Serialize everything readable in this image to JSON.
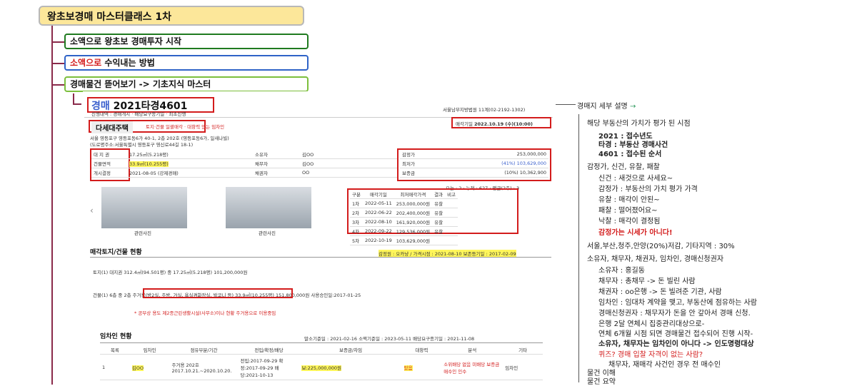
{
  "title": "왕초보경매 마스터클래스 1차",
  "nodes": [
    {
      "text": "소액으로 왕초보 경매투자 시작"
    },
    {
      "text_red": "소액으로",
      "text": " 수익내는 방법"
    },
    {
      "text": "경매물건 뜯어보기 -> 기초지식 마스터"
    }
  ],
  "shot": {
    "case_prefix": "경매",
    "case_no": "2021타경4601",
    "progress": "진행내역 : 경매개시 · 배당요구종기일 · 최초진행",
    "court": "서울남부지방법원 11계(02-2192-1302)",
    "type_badge": "다세대주택",
    "type_note": "토지·건물 일괄매각 · 대항력 있는 임차인",
    "sale_date_label": "매각기일",
    "sale_date": "2022.10.19 (수)(10:00)",
    "address": "서울 영등포구 영등포동6가 40-1, 2층 202호 (영등포동6가, 일새나빌)",
    "address2": "(도로명주소:서울특별시 영등포구 영신로44길 18-1)",
    "info_rows": [
      {
        "k": "대 지 권",
        "v": "17.25㎡(5.218평)",
        "k2": "소유자",
        "v2": "김OO"
      },
      {
        "k": "건물면적",
        "v": "33.9㎡(10.255평)",
        "k2": "채무자",
        "v2": "김OO"
      },
      {
        "k": "개시결정",
        "v": "2021-08-05 (강제경매)",
        "k2": "채권자",
        "v2": "OO"
      }
    ],
    "price_rows": [
      {
        "k": "감정가",
        "v": "253,000,000"
      },
      {
        "k": "최저가",
        "v": "(41%) 103,629,000"
      },
      {
        "k": "보증금",
        "v": "(10%) 10,362,900"
      }
    ],
    "stats": "오늘 : 2 · 누적 : 627 · 평균(2주) : 3",
    "photo_labels": [
      "관련사진",
      "관련사진"
    ],
    "bid_headers": [
      "구분",
      "매각기일",
      "최저매각가격",
      "결과",
      "비고"
    ],
    "bid_rows": [
      [
        "1차",
        "2022-05-11",
        "253,000,000원",
        "유찰",
        ""
      ],
      [
        "2차",
        "2022-06-22",
        "202,400,000원",
        "유찰",
        ""
      ],
      [
        "3차",
        "2022-08-10",
        "161,920,000원",
        "유찰",
        ""
      ],
      [
        "4차",
        "2022-09-22",
        "129,536,000원",
        "유찰",
        ""
      ],
      [
        "5차",
        "2022-10-19",
        "103,629,000원",
        "",
        ""
      ]
    ],
    "land_title": "매각토지/건물 현황",
    "land_note": "감정원 : 오카냥 / 가격시점 : 2021-08-10 보존등기일 : 2017-02-09",
    "land_rows": [
      "토지(1)   대지권 312.4㎡(94.501평) 중 17.25㎡(5.218평)   101,200,000원",
      "건물(1)   6층 중 2층 주거용(방2실, 주방, 거실, 욕실겸화장실, 발코니 등)   33.9㎡(10.255평)   151,800,000원   사용승인일:2017-01-25"
    ],
    "land_warn": "* 공부상 용도 제2종근린생활시설(사무소)이나 현황 주거용으로 이용중임",
    "tenant_title": "임차인 현황",
    "tenant_dates": "말소기준일 : 2021-02-16   소액기준일 : 2023-05-11   배당요구종기일 : 2021-11-08",
    "tenant_headers": [
      "목록",
      "임차인",
      "점유부분/기간",
      "전입/확정/배당",
      "보증금/차임",
      "대항력",
      "분석",
      "기타"
    ],
    "tenant_row": [
      "1",
      "김OO",
      "주거용 202호 2017.10.21.~2020.10.20.",
      "전입:2017-09-29 확정:2017-09-29 배당:2021-10-13",
      "보:225,000,000원",
      "있음",
      "소위배당 없음 미배당 보증금 매수인 인수",
      "임차인"
    ]
  },
  "right": {
    "head": "경매지 세부 설명",
    "items": [
      "해당 부동산의 가치가 평가 된 시점",
      "2021 : 접수년도",
      "타경 : 부동산 경매사건",
      "4601 : 접수된 순서",
      "감정가, 신건, 유찰, 패찰",
      "신건 : 새것으로 사세요~",
      "감정가 : 부동산의 가치 평가 가격",
      "유찰 : 매각이 안된~",
      "패찰 : 떨어졌어요~",
      "낙찰 : 매각이 결정됨",
      "감정가는 시세가 아니다!",
      "서울,부산,청주,안양(20%)저감, 기타지역 : 30%",
      "소유자, 채무자, 채권자, 임차인, 경매신청권자",
      "소유자 : 홍길동",
      "채무자 : 총채무 -> 돈 빌린 사람",
      "채권자 : oo은행 -> 돈 빌려준 기관, 사람",
      "임차인 : 임대차 계약을 맺고, 부동산에 점유하는 사람",
      "경매신청권자 : 채무자가 돈을 안 갚아서 경매 신청.",
      "은행 2달 연체시 집중관리대상으로-",
      "연체 6개월 시점 되면 경매물건 접수되어 진행 시작-",
      "소유자, 채무자는 임차인이 아니다 -> 인도명령대상",
      "퀴즈? 경매 입찰 자격이 없는 사람?",
      "채무자, 재매각 사건인 경우 전 매수인",
      "물건 이해",
      "물건 요약"
    ]
  },
  "colors": {
    "accent_red": "#d31c1c",
    "top_fill": "#fce79a",
    "node1": "#1f7a1f",
    "node2": "#2f63c7",
    "node3": "#7cbf3c"
  }
}
